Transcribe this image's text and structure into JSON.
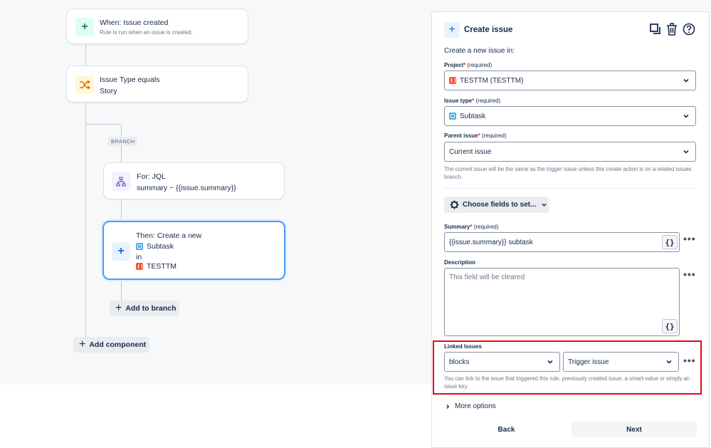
{
  "canvas": {
    "trigger": {
      "title": "When: Issue created",
      "subtitle": "Rule is run when an issue is created."
    },
    "condition": {
      "title": "Issue Type equals",
      "subtitle": "Story"
    },
    "branch_tag": "BRANCH",
    "branch": {
      "title": "For: JQL",
      "subtitle": "summary ~ {{issue.summary}}"
    },
    "action": {
      "title": "Then: Create a new",
      "type": "Subtask",
      "in": "in",
      "project": "TESTTM"
    },
    "add_to_branch": "Add to branch",
    "add_component": "Add component",
    "icons": {
      "trigger": "plus-icon",
      "condition": "shuffle-icon",
      "branch": "hierarchy-icon",
      "action": "plus-icon"
    }
  },
  "panel": {
    "title": "Create issue",
    "intro": "Create a new issue in:",
    "project": {
      "label": "Project",
      "required": "(required)",
      "value": "TESTTM (TESTTM)"
    },
    "issue_type": {
      "label": "Issue type",
      "required": "(required)",
      "value": "Subtask"
    },
    "parent_issue": {
      "label": "Parent issue",
      "required": "(required)",
      "value": "Current issue",
      "help": "The current issue will be the same as the trigger issue unless this create action is on a related issues branch."
    },
    "choose_fields": "Choose fields to set...",
    "summary": {
      "label": "Summary",
      "required": "(required)",
      "value": "{{issue.summary}} subtask"
    },
    "description": {
      "label": "Description",
      "placeholder": "This field will be cleared"
    },
    "linked_issues": {
      "label": "Linked Issues",
      "link_type": "blocks",
      "target": "Trigger issue",
      "help": "You can link to the issue that triggered this rule, previously created issue, a smart-value or simply an issue key."
    },
    "more_options": "More options",
    "back": "Back",
    "next": "Next",
    "smart_value_glyph": "{}",
    "highlight_color": "#e50914"
  }
}
